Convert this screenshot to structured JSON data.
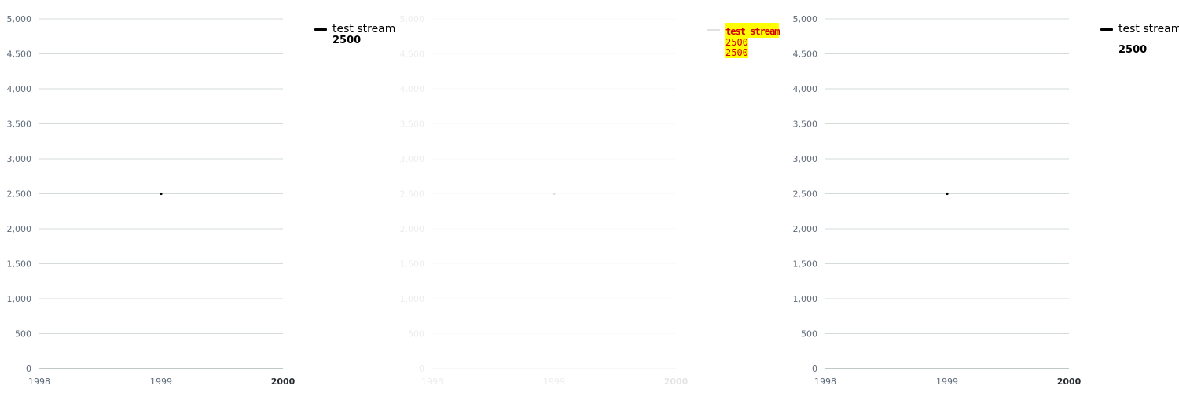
{
  "colors": {
    "series": "#000000",
    "grid": "#d5dbdb",
    "axis": "#aab7b8",
    "tick": "#5f6b7a",
    "highlight_bg": "#ffff00",
    "highlight_fg": "#d40000"
  },
  "chart_data": [
    {
      "type": "scatter",
      "title": "",
      "xlabel": "",
      "ylabel": "",
      "xlim": [
        1998,
        2000
      ],
      "ylim": [
        0,
        5000
      ],
      "x_ticks": [
        "1998",
        "1999",
        "2000"
      ],
      "y_ticks": [
        "0",
        "500",
        "1,000",
        "1,500",
        "2,000",
        "2,500",
        "3,000",
        "3,500",
        "4,000",
        "4,500",
        "5,000"
      ],
      "grid": true,
      "legend_position": "right",
      "series": [
        {
          "name": "test stream",
          "x": [
            1999
          ],
          "y": [
            2500
          ],
          "legend_values": [
            "2500"
          ]
        }
      ]
    },
    {
      "type": "scatter",
      "title": "",
      "xlabel": "",
      "ylabel": "",
      "xlim": [
        1998,
        2000
      ],
      "ylim": [
        0,
        5000
      ],
      "x_ticks": [
        "1998",
        "1999",
        "2000"
      ],
      "y_ticks": [
        "0",
        "500",
        "1,000",
        "1,500",
        "2,000",
        "2,500",
        "3,000",
        "3,500",
        "4,000",
        "4,500",
        "5,000"
      ],
      "grid": true,
      "legend_position": "right",
      "series": [
        {
          "name": "test stream",
          "x": [
            1999
          ],
          "y": [
            2500
          ],
          "legend_values": [
            "2500",
            "2500"
          ]
        }
      ]
    },
    {
      "type": "scatter",
      "title": "",
      "xlabel": "",
      "ylabel": "",
      "xlim": [
        1998,
        2000
      ],
      "ylim": [
        0,
        5000
      ],
      "x_ticks": [
        "1998",
        "1999",
        "2000"
      ],
      "y_ticks": [
        "0",
        "500",
        "1,000",
        "1,500",
        "2,000",
        "2,500",
        "3,000",
        "3,500",
        "4,000",
        "4,500",
        "5,000"
      ],
      "grid": true,
      "legend_position": "right",
      "series": [
        {
          "name": "test stream",
          "x": [
            1999
          ],
          "y": [
            2500
          ],
          "legend_values": [
            "2500"
          ]
        }
      ]
    }
  ]
}
